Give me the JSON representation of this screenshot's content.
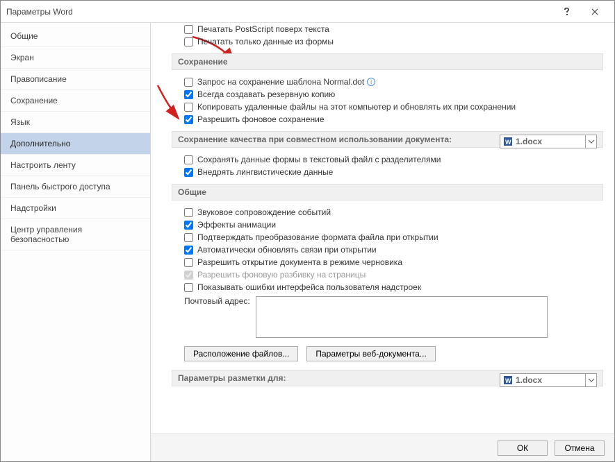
{
  "window": {
    "title": "Параметры Word"
  },
  "sidebar": {
    "items": [
      {
        "label": "Общие"
      },
      {
        "label": "Экран"
      },
      {
        "label": "Правописание"
      },
      {
        "label": "Сохранение"
      },
      {
        "label": "Язык"
      },
      {
        "label": "Дополнительно",
        "selected": true
      },
      {
        "label": "Настроить ленту"
      },
      {
        "label": "Панель быстрого доступа"
      },
      {
        "label": "Надстройки"
      },
      {
        "label": "Центр управления безопасностью"
      }
    ]
  },
  "sections": {
    "cut_top": {
      "opt_postscript": "Печатать PostScript поверх текста",
      "opt_form_data": "Печатать только данные из формы"
    },
    "save": {
      "header": "Сохранение",
      "opt_prompt_normal": "Запрос на сохранение шаблона Normal.dot",
      "opt_backup": "Всегда создавать резервную копию",
      "opt_copy_remote": "Копировать удаленные файлы на этот компьютер и обновлять их при сохранении",
      "opt_bg_save": "Разрешить фоновое сохранение"
    },
    "fidelity": {
      "header": "Сохранение качества при совместном использовании документа:",
      "doc": "1.docx",
      "opt_form_text": "Сохранять данные формы в текстовый файл с разделителями",
      "opt_ling": "Внедрять лингвистические данные"
    },
    "general": {
      "header": "Общие",
      "opt_sound": "Звуковое сопровождение событий",
      "opt_anim": "Эффекты анимации",
      "opt_confirm_conv": "Подтверждать преобразование формата файла при открытии",
      "opt_auto_links": "Автоматически обновлять связи при открытии",
      "opt_draft": "Разрешить открытие документа в режиме черновика",
      "opt_bg_repag": "Разрешить фоновую разбивку на страницы",
      "opt_addin_err": "Показывать ошибки интерфейса пользователя надстроек",
      "mail_label": "Почтовый адрес:",
      "btn_files": "Расположение файлов...",
      "btn_web": "Параметры веб-документа..."
    },
    "layout": {
      "header": "Параметры разметки для:",
      "doc": "1.docx"
    }
  },
  "footer": {
    "ok": "ОК",
    "cancel": "Отмена"
  }
}
